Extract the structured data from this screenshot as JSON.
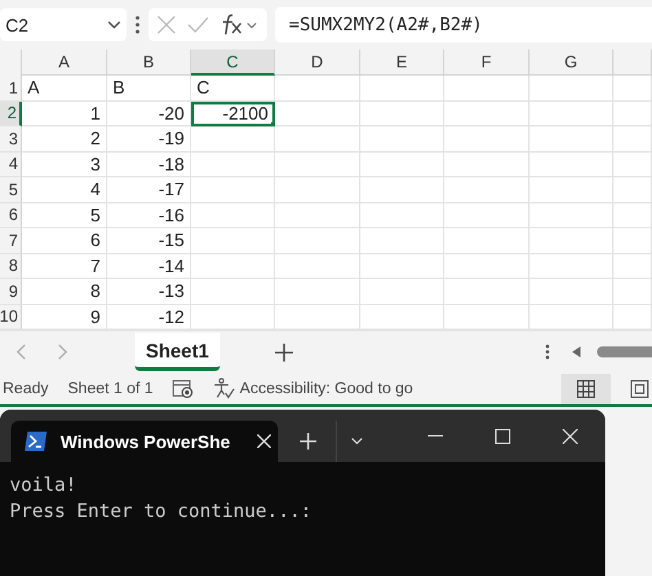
{
  "formula_bar": {
    "name_box": "C2",
    "formula": "=SUMX2MY2(A2#,B2#)"
  },
  "grid": {
    "columns": [
      {
        "label": "A",
        "selected": false
      },
      {
        "label": "B",
        "selected": false
      },
      {
        "label": "C",
        "selected": true
      },
      {
        "label": "D",
        "selected": false
      },
      {
        "label": "E",
        "selected": false
      },
      {
        "label": "F",
        "selected": false
      },
      {
        "label": "G",
        "selected": false
      }
    ],
    "rows": [
      {
        "header": "1",
        "selected": false,
        "cells": [
          {
            "value": "A",
            "kind": "text",
            "selected": false
          },
          {
            "value": "B",
            "kind": "text",
            "selected": false
          },
          {
            "value": "C",
            "kind": "text",
            "selected": false
          }
        ]
      },
      {
        "header": "2",
        "selected": true,
        "cells": [
          {
            "value": "1",
            "kind": "number",
            "selected": false
          },
          {
            "value": "-20",
            "kind": "number",
            "selected": false
          },
          {
            "value": "-2100",
            "kind": "number",
            "selected": true
          }
        ]
      },
      {
        "header": "3",
        "selected": false,
        "cells": [
          {
            "value": "2",
            "kind": "number",
            "selected": false
          },
          {
            "value": "-19",
            "kind": "number",
            "selected": false
          }
        ]
      },
      {
        "header": "4",
        "selected": false,
        "cells": [
          {
            "value": "3",
            "kind": "number",
            "selected": false
          },
          {
            "value": "-18",
            "kind": "number",
            "selected": false
          }
        ]
      },
      {
        "header": "5",
        "selected": false,
        "cells": [
          {
            "value": "4",
            "kind": "number",
            "selected": false
          },
          {
            "value": "-17",
            "kind": "number",
            "selected": false
          }
        ]
      },
      {
        "header": "6",
        "selected": false,
        "cells": [
          {
            "value": "5",
            "kind": "number",
            "selected": false
          },
          {
            "value": "-16",
            "kind": "number",
            "selected": false
          }
        ]
      },
      {
        "header": "7",
        "selected": false,
        "cells": [
          {
            "value": "6",
            "kind": "number",
            "selected": false
          },
          {
            "value": "-15",
            "kind": "number",
            "selected": false
          }
        ]
      },
      {
        "header": "8",
        "selected": false,
        "cells": [
          {
            "value": "7",
            "kind": "number",
            "selected": false
          },
          {
            "value": "-14",
            "kind": "number",
            "selected": false
          }
        ]
      },
      {
        "header": "9",
        "selected": false,
        "cells": [
          {
            "value": "8",
            "kind": "number",
            "selected": false
          },
          {
            "value": "-13",
            "kind": "number",
            "selected": false
          }
        ]
      },
      {
        "header": "10",
        "selected": false,
        "cells": [
          {
            "value": "9",
            "kind": "number",
            "selected": false
          },
          {
            "value": "-12",
            "kind": "number",
            "selected": false
          }
        ]
      }
    ]
  },
  "sheet_tabs": [
    {
      "label": "Sheet1",
      "selected": true
    }
  ],
  "status_bar": {
    "state": "Ready",
    "sheet": "Sheet 1 of 1",
    "accessibility": "Accessibility: Good to go"
  },
  "terminal": {
    "tab_title": "Windows PowerShe",
    "lines": [
      "voila!",
      "Press Enter to continue...:"
    ]
  }
}
